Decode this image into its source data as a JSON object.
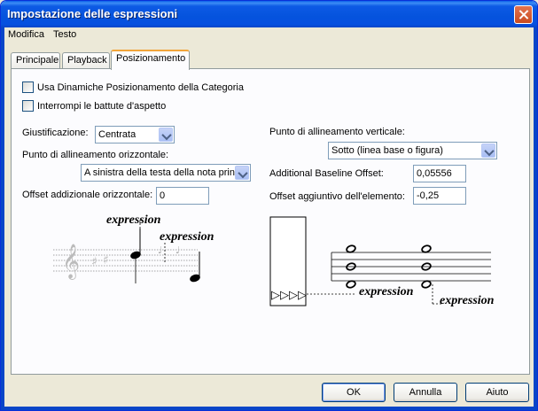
{
  "window": {
    "title": "Impostazione delle espressioni"
  },
  "menu": {
    "items": [
      "Modifica",
      "Testo"
    ]
  },
  "tabs": [
    "Principale",
    "Playback",
    "Posizionamento"
  ],
  "checkboxes": {
    "use_category": "Usa Dinamiche Posizionamento della Categoria",
    "interrupt_rests": "Interrompi le battute d'aspetto"
  },
  "left": {
    "justification_label": "Giustificazione:",
    "justification_value": "Centrata",
    "halign_label": "Punto di allineamento orizzontale:",
    "halign_value": "A sinistra della testa della nota princ",
    "hoffset_label": "Offset addizionale orizzontale:",
    "hoffset_value": "0"
  },
  "right": {
    "valign_label": "Punto di allineamento verticale:",
    "valign_value": "Sotto (linea base o figura)",
    "baseline_label": "Additional Baseline Offset:",
    "baseline_value": "0,05556",
    "element_label": "Offset aggiuntivo dell'elemento:",
    "element_value": "-0,25"
  },
  "illustrations": {
    "word": "expression"
  },
  "buttons": {
    "ok": "OK",
    "cancel": "Annulla",
    "help": "Aiuto"
  },
  "colors": {
    "titlebar": "#0553dd",
    "tab_accent": "#f2a53a",
    "dialog_bg": "#ece9d8"
  }
}
